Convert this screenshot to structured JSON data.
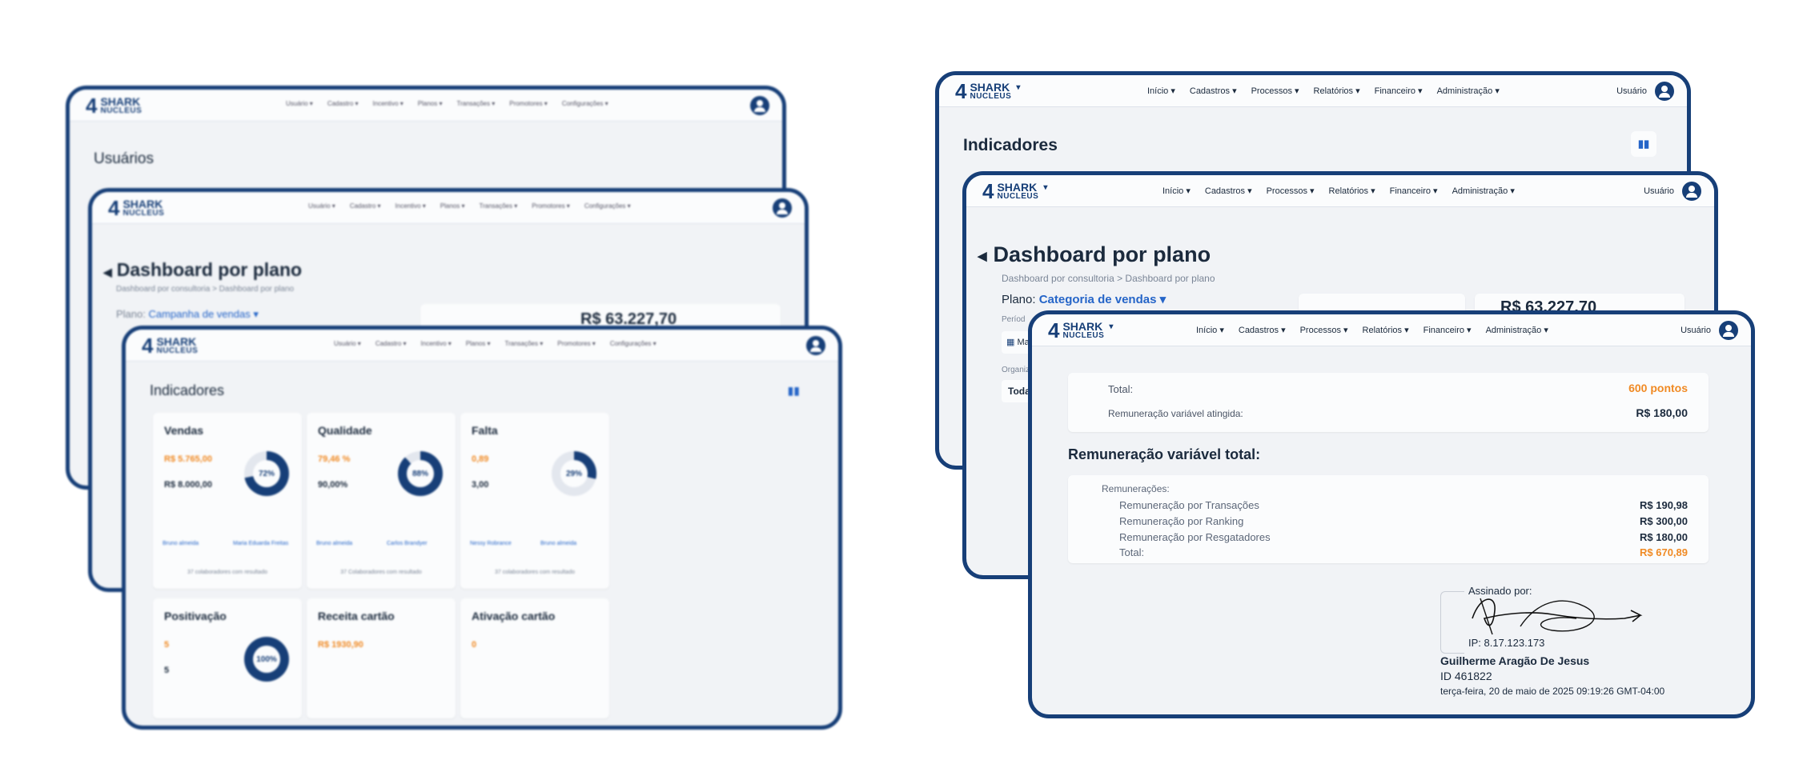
{
  "app": {
    "logo_num": "4",
    "logo_line1": "SHARK",
    "logo_line2": "NUCLEUS",
    "logo_caret": "▾"
  },
  "menu_left_blurred": [
    "Usuário ▾",
    "Cadastro ▾",
    "Incentivo ▾",
    "Planos ▾",
    "Transações ▾",
    "Promotores ▾",
    "Configurações ▾"
  ],
  "menu": [
    "Início ▾",
    "Cadastros ▾",
    "Processos ▾",
    "Relatórios ▾",
    "Financeiro ▾",
    "Administração ▾"
  ],
  "user_label": "Usuário",
  "left": {
    "back_title": "Usuários",
    "mid_title": "Dashboard por plano",
    "mid_breadcrumb": "Dashboard por consultoria > Dashboard por plano",
    "mid_plan_label": "Plano:",
    "mid_plan_value": "Campanha de vendas ▾",
    "mid_amount": "R$ 63.227,70",
    "front_title": "Indicadores",
    "cards": [
      {
        "title": "Vendas",
        "line1": "R$ 5.765,00",
        "line2": "R$ 8.000,00",
        "pct": "72%",
        "ratio": 0.72,
        "footer": "37 colaboradores com resultado",
        "people": [
          "Bruno almeida",
          "Maria Eduarda Freitas"
        ]
      },
      {
        "title": "Qualidade",
        "line1": "79,46 %",
        "line2": "90,00%",
        "pct": "88%",
        "ratio": 0.88,
        "footer": "37 Colaboradores com resultado",
        "people": [
          "Bruno almeida",
          "Carlos Brandyer"
        ]
      },
      {
        "title": "Falta",
        "line1": "0,89",
        "line2": "3,00",
        "pct": "29%",
        "ratio": 0.29,
        "footer": "37 colaboradores com resultado",
        "people": [
          "Nessy Robrance",
          "Bruno almeida"
        ]
      },
      {
        "title": "Positivação",
        "line1": "5",
        "line2": "5",
        "pct": "100%",
        "ratio": 1.0,
        "footer": "",
        "people": []
      },
      {
        "title": "Receita cartão",
        "line1": "R$ 1930,90",
        "line2": "",
        "pct": "",
        "ratio": 0,
        "footer": "",
        "people": []
      },
      {
        "title": "Ativação cartão",
        "line1": "0",
        "line2": "",
        "pct": "",
        "ratio": 0,
        "footer": "",
        "people": []
      }
    ],
    "truncated_letters": "In"
  },
  "right": {
    "back_title": "Indicadores",
    "mid_title": "Dashboard por plano",
    "mid_breadcrumb": "Dashboard por consultoria > Dashboard por plano",
    "mid_plan_label": "Plano:",
    "mid_plan_value": "Categoria de vendas ▾",
    "mid_amount": "R$ 63.227,70",
    "mid_period_label": "Períod",
    "mid_date_text": "Ma",
    "mid_org_label": "Organiz",
    "mid_org_value": "Toda",
    "front": {
      "total_label": "Total:",
      "total_value": "600 pontos",
      "rva_label": "Remuneração variável atingida:",
      "rva_value": "R$ 180,00",
      "section_title": "Remuneração variável total:",
      "rem_label": "Remunerações:",
      "rows": [
        {
          "label": "Remuneração por Transações",
          "value": "R$ 190,98"
        },
        {
          "label": "Remuneração por Ranking",
          "value": "R$ 300,00"
        },
        {
          "label": "Remuneração por Resgatadores",
          "value": "R$ 180,00"
        }
      ],
      "grand_label": "Total:",
      "grand_value": "R$ 670,89",
      "signed_by": "Assinado por:",
      "ip": "IP: 8.17.123.173",
      "signer_name": "Guilherme Aragão De Jesus",
      "signer_id": "ID 461822",
      "signed_at": "terça-feira, 20 de maio de 2025 09:19:26 GMT-04:00"
    }
  },
  "colors": {
    "brand": "#173f78",
    "accent": "#f08a24",
    "link": "#2565c8"
  }
}
